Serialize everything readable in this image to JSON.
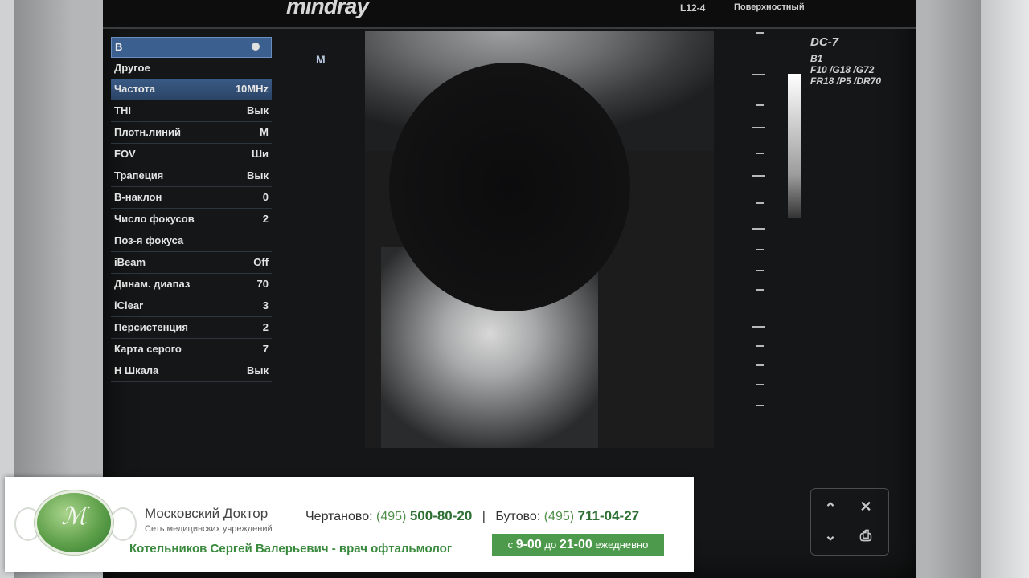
{
  "monitor": {
    "brand": "mindray",
    "probe": "L12-4",
    "preset": "Поверхностный",
    "m_label": "M"
  },
  "menu": {
    "header": "B",
    "items": [
      {
        "label": "Другое",
        "value": ""
      },
      {
        "label": "Частота",
        "value": "10MHz"
      },
      {
        "label": "THI",
        "value": "Вык"
      },
      {
        "label": "Плотн.линий",
        "value": "M"
      },
      {
        "label": "FOV",
        "value": "Ши"
      },
      {
        "label": "Трапеция",
        "value": "Вык"
      },
      {
        "label": "B-наклон",
        "value": "0"
      },
      {
        "label": "Число фокусов",
        "value": "2"
      },
      {
        "label": "Поз-я фокуса",
        "value": ""
      },
      {
        "label": "iBeam",
        "value": "Off"
      },
      {
        "label": "Динам. диапаз",
        "value": "70"
      },
      {
        "label": "iClear",
        "value": "3"
      },
      {
        "label": "Персистенция",
        "value": "2"
      },
      {
        "label": "Карта серого",
        "value": "7"
      },
      {
        "label": "Н Шкала",
        "value": "Вык"
      }
    ]
  },
  "status": {
    "title": "DC-7",
    "mode": "B1",
    "line1": [
      "F10",
      "/G18",
      "/G72"
    ],
    "line2": [
      "FR18",
      "/P5",
      "/DR70"
    ]
  },
  "banner": {
    "clinic_name": "Московский Доктор",
    "clinic_subtitle": "Сеть медицинских учреждений",
    "doctor": "Котельников Сергей Валерьевич - врач офтальмолог",
    "phone1_label": "Чертаново:",
    "phone1_code": "(495)",
    "phone1_number": "500-80-20",
    "separator": "|",
    "phone2_label": "Бутово:",
    "phone2_code": "(495)",
    "phone2_number": "711-04-27",
    "hours_prefix": "с",
    "hours_from": "9-00",
    "hours_mid": "до",
    "hours_to": "21-00",
    "hours_suffix": "ежедневно"
  },
  "controls": {
    "up_icon": "double-chevron-up-icon",
    "close_icon": "close-icon",
    "down_icon": "double-chevron-down-icon",
    "print_icon": "print-icon"
  }
}
